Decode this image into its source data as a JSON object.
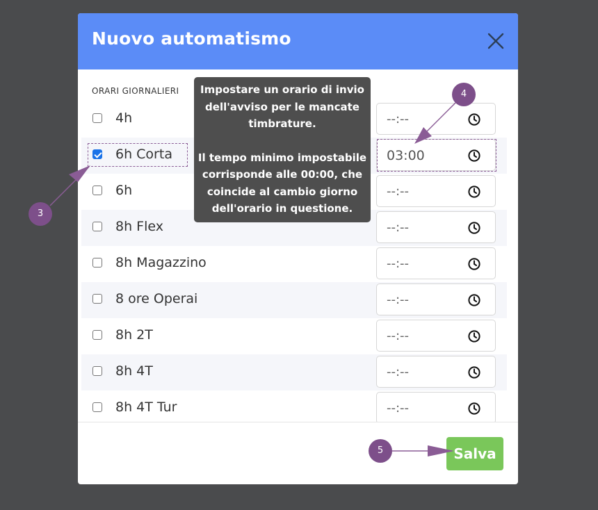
{
  "modal": {
    "title": "Nuovo automatismo",
    "section_label": "ORARI GIORNALIERI",
    "placeholder_time": "--:--",
    "rows": [
      {
        "label": "4h",
        "checked": false,
        "time": ""
      },
      {
        "label": "6h Corta",
        "checked": true,
        "time": "03:00"
      },
      {
        "label": "6h",
        "checked": false,
        "time": ""
      },
      {
        "label": "8h Flex",
        "checked": false,
        "time": ""
      },
      {
        "label": "8h Magazzino",
        "checked": false,
        "time": ""
      },
      {
        "label": "8 ore Operai",
        "checked": false,
        "time": ""
      },
      {
        "label": "8h 2T",
        "checked": false,
        "time": ""
      },
      {
        "label": "8h 4T",
        "checked": false,
        "time": ""
      },
      {
        "label": "8h 4T Tur",
        "checked": false,
        "time": ""
      }
    ],
    "save_label": "Salva"
  },
  "tooltip": {
    "line1": "Impostare un orario di invio",
    "line2": "dell'avviso per le mancate",
    "line3": "timbrature.",
    "line4": "Il tempo minimo impostabile",
    "line5": "corrisponde alle 00:00, che",
    "line6": "coincide al cambio giorno",
    "line7": "dell'orario in questione."
  },
  "callouts": {
    "three": "3",
    "four": "4",
    "five": "5"
  },
  "colors": {
    "header": "#5b8cf7",
    "save": "#7ac75a",
    "callout": "#7d4f8a",
    "overlay": "#4a4b4d"
  },
  "icons": {
    "close": "close-icon",
    "info": "info-icon",
    "clock": "clock-icon"
  }
}
